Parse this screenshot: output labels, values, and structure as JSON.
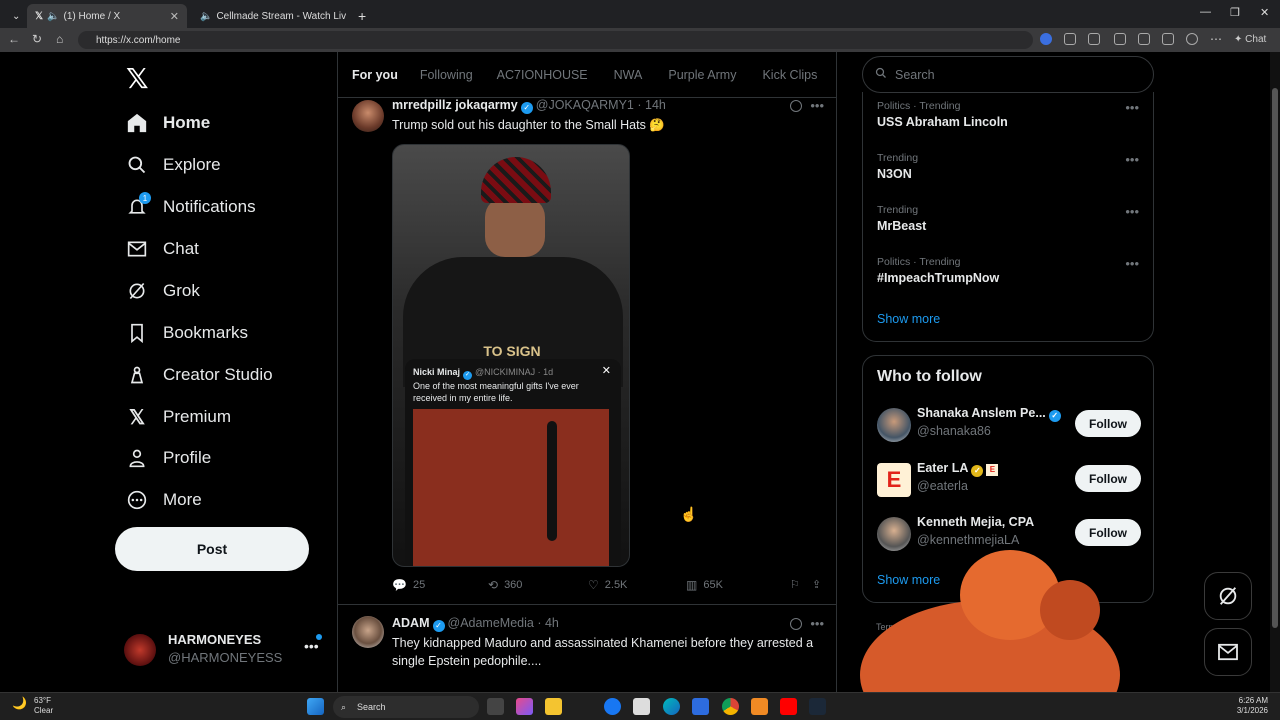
{
  "browser": {
    "tabs": [
      {
        "title": "(1) Home / X",
        "active": true
      },
      {
        "title": "Cellmade Stream - Watch Liv",
        "active": false
      }
    ],
    "url": "https://x.com/home",
    "chat_label": "Chat"
  },
  "sidebar": {
    "items": [
      {
        "label": "Home",
        "icon": "home-icon"
      },
      {
        "label": "Explore",
        "icon": "search-icon"
      },
      {
        "label": "Notifications",
        "icon": "bell-icon",
        "badge": "1"
      },
      {
        "label": "Chat",
        "icon": "envelope-icon"
      },
      {
        "label": "Grok",
        "icon": "grok-icon"
      },
      {
        "label": "Bookmarks",
        "icon": "bookmark-icon"
      },
      {
        "label": "Creator Studio",
        "icon": "creator-studio-icon"
      },
      {
        "label": "Premium",
        "icon": "x-premium-icon"
      },
      {
        "label": "Profile",
        "icon": "person-icon"
      },
      {
        "label": "More",
        "icon": "more-circle-icon"
      }
    ],
    "post_label": "Post",
    "account": {
      "name": "HARMONEYES",
      "handle": "@HARMONEYESS"
    }
  },
  "feed": {
    "tabs": [
      "For you",
      "Following",
      "AC7IONHOUSE",
      "NWA",
      "Purple Army",
      "Kick Clips"
    ],
    "posts": [
      {
        "name": "mrredpillz jokaqarmy",
        "handle": "@JOKAQARMY1",
        "time": "14h",
        "text": "Trump sold out his daughter to the Small Hats 🤔",
        "media": {
          "overlay_text": "TO SIGN",
          "embed_name": "Nicki Minaj",
          "embed_handle": "@NICKIMINAJ · 1d",
          "embed_text": "One of the most meaningful gifts I've ever received in my entire life."
        },
        "stats": {
          "replies": "25",
          "reposts": "360",
          "likes": "2.5K",
          "views": "65K"
        }
      },
      {
        "name": "ADAM",
        "handle": "@AdameMedia",
        "time": "4h",
        "text": "They kidnapped Maduro and assassinated Khamenei before they arrested a single Epstein pedophile...."
      }
    ]
  },
  "right": {
    "search_placeholder": "Search",
    "trends": [
      {
        "category": "Politics · Trending",
        "name": "USS Abraham Lincoln"
      },
      {
        "category": "Trending",
        "name": "N3ON"
      },
      {
        "category": "Trending",
        "name": "MrBeast"
      },
      {
        "category": "Politics · Trending",
        "name": "#ImpeachTrumpNow"
      }
    ],
    "show_more": "Show more",
    "who_to_follow_title": "Who to follow",
    "who_to_follow": [
      {
        "name": "Shanaka Anslem Pe...",
        "handle": "@shanaka86",
        "button": "Follow"
      },
      {
        "name": "Eater LA",
        "handle": "@eaterla",
        "button": "Follow"
      },
      {
        "name": "Kenneth Mejia, CPA",
        "handle": "@kennethmejiaLA",
        "button": "Follow"
      }
    ],
    "show_more_2": "Show more",
    "footer": "Terms ...  Policy |  X Corp."
  },
  "taskbar": {
    "weather_temp": "63°F",
    "weather_desc": "Clear",
    "search_label": "Search",
    "time": "6:26 AM",
    "date": "3/1/2026"
  },
  "colors": {
    "accent": "#1d9bf0",
    "background": "#000000",
    "text": "#e7e9ea",
    "muted": "#71767b"
  }
}
